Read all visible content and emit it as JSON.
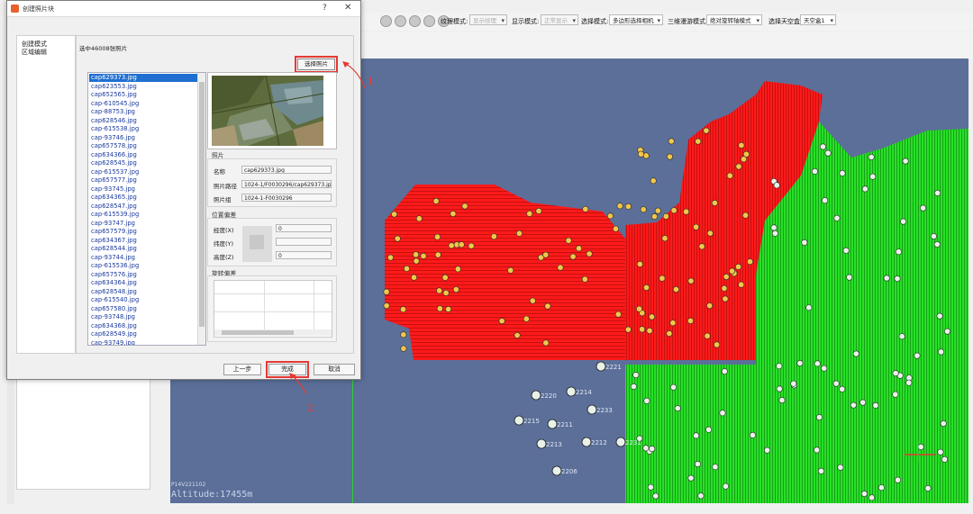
{
  "dialog": {
    "title": "创建照片块",
    "help": "?",
    "close": "✕",
    "nav": [
      "创建模式",
      "区域编辑"
    ],
    "header": "选中46008张照片",
    "select_photo_button": "选择照片",
    "photos": [
      "cap629373.jpg",
      "cap623553.jpg",
      "cap652565.jpg",
      "cap-610545.jpg",
      "cap-88753.jpg",
      "cap628546.jpg",
      "cap-615538.jpg",
      "cap-93746.jpg",
      "cap657578.jpg",
      "cap634366.jpg",
      "cap628545.jpg",
      "cap-615537.jpg",
      "cap657577.jpg",
      "cap-93745.jpg",
      "cap634365.jpg",
      "cap628547.jpg",
      "cap-615539.jpg",
      "cap-93747.jpg",
      "cap657579.jpg",
      "cap634367.jpg",
      "cap628544.jpg",
      "cap-93744.jpg",
      "cap-615536.jpg",
      "cap657576.jpg",
      "cap634364.jpg",
      "cap628548.jpg",
      "cap-615540.jpg",
      "cap657580.jpg",
      "cap-93748.jpg",
      "cap634368.jpg",
      "cap628549.jpg",
      "cap-93749.jpg"
    ],
    "photo_group": {
      "label": "照片",
      "name_label": "名称",
      "name_value": "cap629373.jpg",
      "path_label": "照片路径",
      "path_value": "1024-1/F0030296/cap629373.jpg",
      "group_label": "照片组",
      "group_value": "1024-1-F0030296"
    },
    "position_group": {
      "label": "位置偏差",
      "x_label": "经度(X)",
      "x_value": "0",
      "y_label": "纬度(Y)",
      "y_value": "",
      "z_label": "高度(Z)",
      "z_value": "0"
    },
    "rotation_group": {
      "label": "旋转偏差"
    },
    "buttons": {
      "prev": "上一步",
      "finish": "完成",
      "cancel": "取消"
    }
  },
  "toolbar": {
    "texture_mode_label": "纹理模式:",
    "texture_mode_value": "显示纹理",
    "display_mode_label": "显示模式:",
    "display_mode_value": "正常显示",
    "select_mode_label": "选择模式:",
    "select_mode_value": "多边形选择相机",
    "roam_mode_label": "三维漫游模式:",
    "roam_mode_value": "绝对旋转轴模式",
    "sky_label": "选择天空盒:",
    "sky_value": "天空盒1"
  },
  "viewport": {
    "altitude": "Altitude:17455m",
    "camera_label": "P14V221102",
    "point_labels": [
      "2220",
      "2214",
      "2233",
      "2215",
      "2211",
      "2213",
      "2212",
      "2206",
      "2221",
      "2231"
    ]
  },
  "annotations": [
    "1",
    "2"
  ],
  "colors": {
    "selected_cameras": "#ff1a1a",
    "cameras": "#22e022",
    "background": "#5b6f99",
    "highlight": "#e53935"
  }
}
